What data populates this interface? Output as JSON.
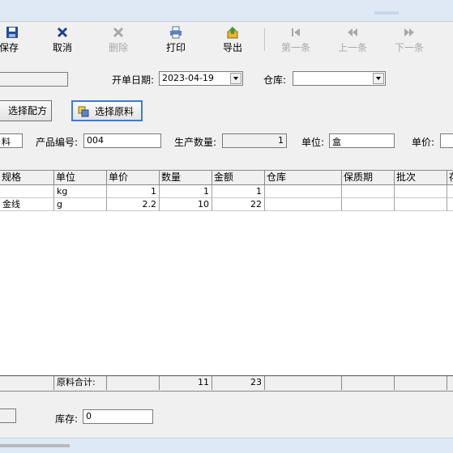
{
  "toolbar": {
    "save": "保存",
    "cancel": "取消",
    "delete": "删除",
    "print": "打印",
    "export": "导出",
    "first": "第一条",
    "prev": "上一条",
    "next": "下一条"
  },
  "form": {
    "date_label": "开单日期:",
    "date_value": "2023-04-19",
    "warehouse_label": "仓库:",
    "warehouse_value": "",
    "select_formula": "选择配方",
    "select_material": "选择原料",
    "left_partial_value": "料",
    "product_code_label": "产品编号:",
    "product_code_value": "004",
    "quantity_label": "生产数量:",
    "quantity_value": "1",
    "unit_label": "单位:",
    "unit_value": "盒",
    "price_label": "单价:",
    "stock_label": "库存:",
    "stock_value": "0"
  },
  "table": {
    "columns": [
      "规格",
      "单位",
      "单价",
      "数量",
      "金额",
      "仓库",
      "保质期",
      "批次",
      "存"
    ],
    "rows": [
      {
        "spec": "",
        "unit": "kg",
        "price": "1",
        "qty": "1",
        "amount": "1"
      },
      {
        "spec": "金线",
        "unit": "g",
        "price": "2.2",
        "qty": "10",
        "amount": "22"
      }
    ],
    "footer": {
      "label": "原料合计:",
      "qty": "11",
      "amount": "23"
    }
  },
  "colors": {
    "title_bar": "#dfe9f5",
    "selected_border": "#3d7bd6",
    "disabled_text": "#a8a8a8"
  }
}
